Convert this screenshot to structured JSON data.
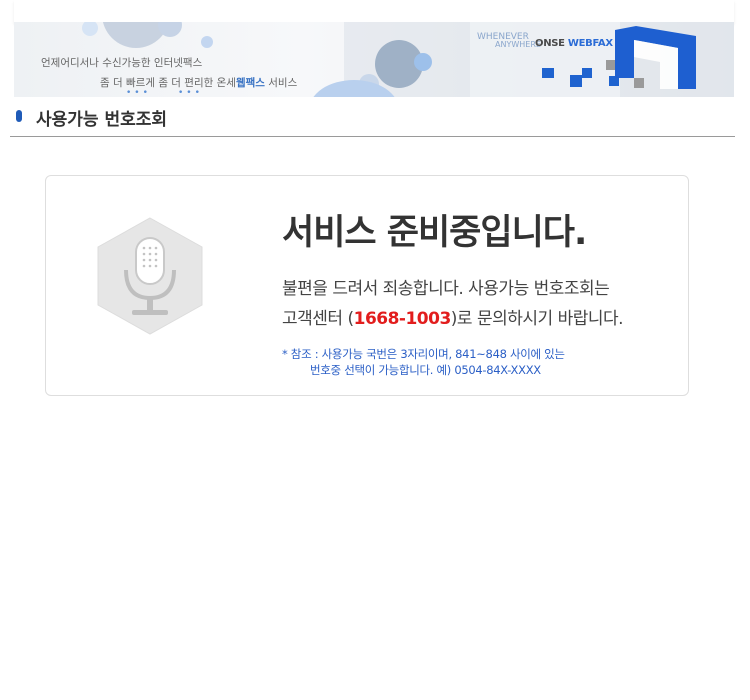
{
  "banner": {
    "tagline_line1": "언제어디서나 수신가능한 인터넷팩스",
    "tagline_line2_prefix": "좀 더 빠르게 좀 더 편리한 온세",
    "tagline_line2_highlight": "웹팩스",
    "tagline_line2_suffix": " 서비스",
    "slogan_word1": "WHENEVER",
    "slogan_word2": "ANYWHERE",
    "brand_text": "ONSE",
    "brand_highlight": "WEBFAX",
    "accent_color": "#2b6cd6"
  },
  "page": {
    "section_title": "사용가능 번호조회"
  },
  "notice": {
    "icon": "microphone-icon",
    "headline": "서비스 준비중입니다.",
    "message_line1": "불편을 드려서 죄송합니다. 사용가능 번호조회는",
    "message_line2_prefix": "고객센터 (",
    "phone": "1668-1003",
    "message_line2_suffix": ")로 문의하시기 바랍니다.",
    "phone_color": "#e21d1d",
    "note_line1": "* 참조 : 사용가능 국번은 3자리이며, 841~848 사이에 있는",
    "note_line2": "번호중 선택이 가능합니다. 예) 0504-84X-XXXX",
    "note_color": "#2b5fc6"
  }
}
